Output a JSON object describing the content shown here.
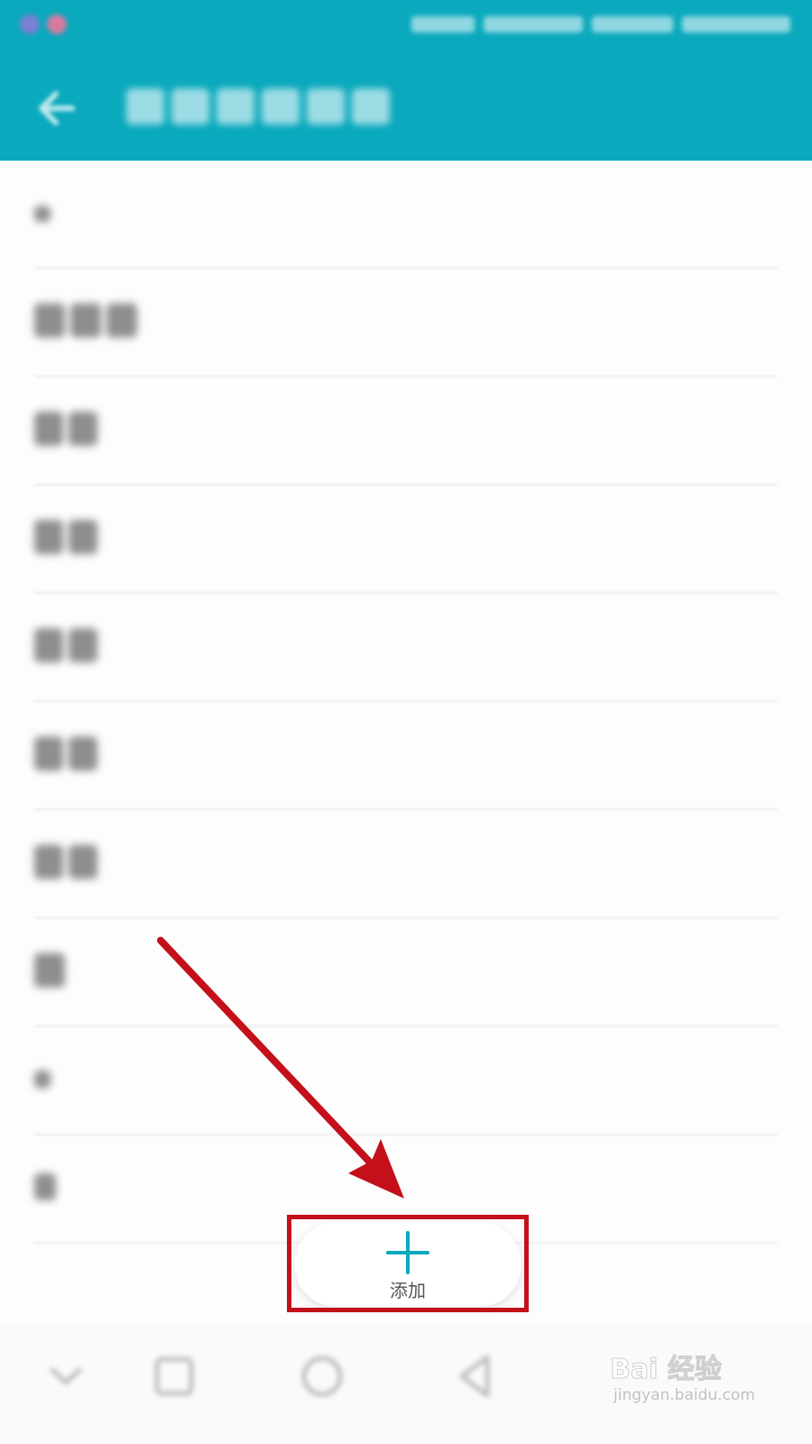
{
  "colors": {
    "header": "#0aa9bd",
    "accent": "#0aa9bd",
    "annotation_red": "#c4101a"
  },
  "header": {
    "back_icon": "back-arrow-icon"
  },
  "add_button": {
    "label": "添加",
    "icon": "plus-icon"
  },
  "watermark": {
    "brand": "Bai 经验",
    "url": "jingyan.baidu.com"
  },
  "nav_bar": {
    "icons": [
      "collapse-chevron-icon",
      "recents-square-icon",
      "home-circle-icon",
      "back-triangle-icon"
    ]
  }
}
